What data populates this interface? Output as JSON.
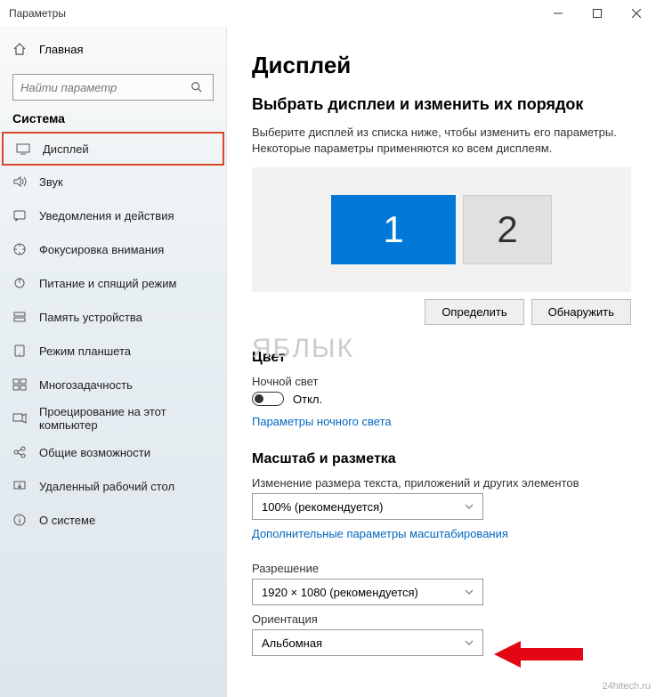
{
  "titlebar": {
    "title": "Параметры"
  },
  "sidebar": {
    "home_label": "Главная",
    "search_placeholder": "Найти параметр",
    "category": "Система",
    "items": [
      {
        "label": "Дисплей",
        "selected": true
      },
      {
        "label": "Звук"
      },
      {
        "label": "Уведомления и действия"
      },
      {
        "label": "Фокусировка внимания"
      },
      {
        "label": "Питание и спящий режим"
      },
      {
        "label": "Память устройства"
      },
      {
        "label": "Режим планшета"
      },
      {
        "label": "Многозадачность"
      },
      {
        "label": "Проецирование на этот компьютер"
      },
      {
        "label": "Общие возможности"
      },
      {
        "label": "Удаленный рабочий стол"
      },
      {
        "label": "О системе"
      }
    ]
  },
  "main": {
    "h1": "Дисплей",
    "arrange_h2": "Выбрать дисплеи и изменить их порядок",
    "arrange_desc": "Выберите дисплей из списка ниже, чтобы изменить его параметры. Некоторые параметры применяются ко всем дисплеям.",
    "monitors": {
      "m1": "1",
      "m2": "2"
    },
    "btn_identify": "Определить",
    "btn_detect": "Обнаружить",
    "color_h3": "Цвет",
    "night_label": "Ночной свет",
    "toggle_state": "Откл.",
    "night_link": "Параметры ночного света",
    "scale_h3": "Масштаб и разметка",
    "scale_label": "Изменение размера текста, приложений и других элементов",
    "scale_value": "100% (рекомендуется)",
    "scale_link": "Дополнительные параметры масштабирования",
    "res_label": "Разрешение",
    "res_value": "1920 × 1080 (рекомендуется)",
    "orient_label": "Ориентация",
    "orient_value": "Альбомная"
  },
  "watermark": "ЯБЛЫК",
  "footer": "24hitech.ru"
}
